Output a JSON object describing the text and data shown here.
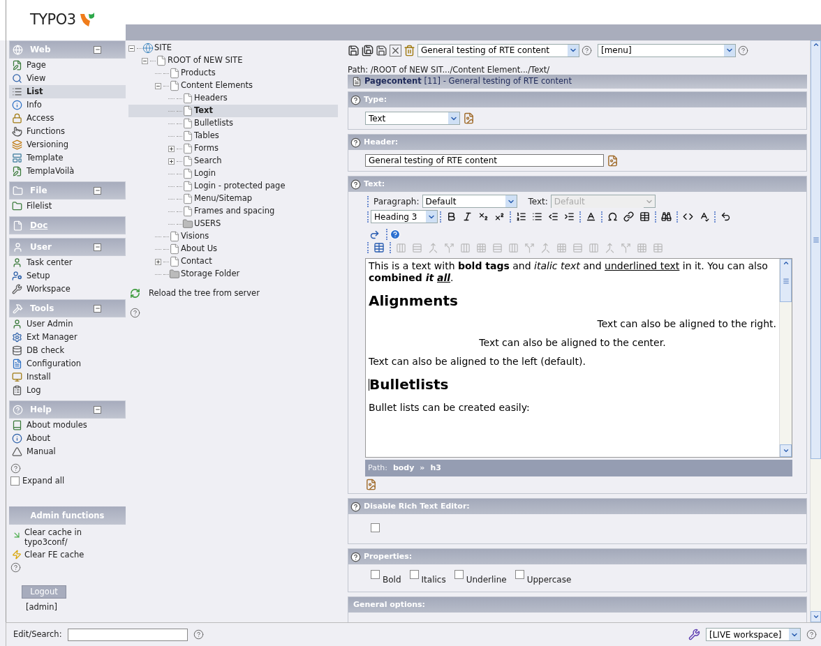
{
  "logo": {
    "text": "TYPO3"
  },
  "modules": [
    {
      "title": "Web",
      "collapsible": true,
      "link": false,
      "items": [
        {
          "label": "Page",
          "selected": false
        },
        {
          "label": "View",
          "selected": false
        },
        {
          "label": "List",
          "selected": true
        },
        {
          "label": "Info",
          "selected": false
        },
        {
          "label": "Access",
          "selected": false
        },
        {
          "label": "Functions",
          "selected": false
        },
        {
          "label": "Versioning",
          "selected": false
        },
        {
          "label": "Template",
          "selected": false
        },
        {
          "label": "TemplaVoilà",
          "selected": false
        }
      ]
    },
    {
      "title": "File",
      "collapsible": true,
      "link": false,
      "items": [
        {
          "label": "Filelist",
          "selected": false
        }
      ]
    },
    {
      "title": "Doc",
      "collapsible": false,
      "link": true
    },
    {
      "title": "User",
      "collapsible": true,
      "link": false,
      "items": [
        {
          "label": "Task center",
          "selected": false
        },
        {
          "label": "Setup",
          "selected": false
        },
        {
          "label": "Workspace",
          "selected": false
        }
      ]
    },
    {
      "title": "Tools",
      "collapsible": true,
      "link": false,
      "items": [
        {
          "label": "User Admin",
          "selected": false
        },
        {
          "label": "Ext Manager",
          "selected": false
        },
        {
          "label": "DB check",
          "selected": false
        },
        {
          "label": "Configuration",
          "selected": false
        },
        {
          "label": "Install",
          "selected": false
        },
        {
          "label": "Log",
          "selected": false
        }
      ]
    },
    {
      "title": "Help",
      "collapsible": true,
      "link": false,
      "items": [
        {
          "label": "About modules",
          "selected": false
        },
        {
          "label": "About",
          "selected": false
        },
        {
          "label": "Manual",
          "selected": false
        }
      ]
    }
  ],
  "expand_all": {
    "label": "Expand all",
    "checked": false
  },
  "admin_functions": {
    "title": "Admin functions",
    "items": [
      "Clear cache in typo3conf/",
      "Clear FE cache"
    ]
  },
  "logout": {
    "label": "Logout",
    "user": "[admin]"
  },
  "tree": {
    "root": {
      "label": "SITE",
      "kind": "site",
      "expanded": true,
      "selected": false,
      "children": [
        {
          "label": "ROOT of NEW SITE",
          "kind": "page",
          "expanded": true,
          "selected": false,
          "children": [
            {
              "label": "Products",
              "kind": "page",
              "selected": false
            },
            {
              "label": "Content Elements",
              "kind": "page",
              "expanded": true,
              "selected": false,
              "children": [
                {
                  "label": "Headers",
                  "kind": "page",
                  "selected": false
                },
                {
                  "label": "Text",
                  "kind": "page",
                  "selected": true
                },
                {
                  "label": "Bulletlists",
                  "kind": "page",
                  "selected": false
                },
                {
                  "label": "Tables",
                  "kind": "page",
                  "selected": false
                },
                {
                  "label": "Forms",
                  "kind": "page",
                  "expanded": false,
                  "selected": false
                },
                {
                  "label": "Search",
                  "kind": "page",
                  "expanded": false,
                  "selected": false
                },
                {
                  "label": "Login",
                  "kind": "page",
                  "selected": false
                },
                {
                  "label": "Login - protected page",
                  "kind": "page",
                  "selected": false
                },
                {
                  "label": "Menu/Sitemap",
                  "kind": "page",
                  "selected": false
                },
                {
                  "label": "Frames and spacing",
                  "kind": "page",
                  "selected": false
                },
                {
                  "label": "USERS",
                  "kind": "folder",
                  "selected": false
                }
              ]
            },
            {
              "label": "Visions",
              "kind": "page",
              "selected": false
            },
            {
              "label": "About Us",
              "kind": "page",
              "selected": false
            },
            {
              "label": "Contact",
              "kind": "page",
              "expanded": false,
              "selected": false
            },
            {
              "label": "Storage Folder",
              "kind": "folder",
              "selected": false
            }
          ]
        }
      ]
    }
  },
  "reload": "Reload the tree from server",
  "doc_toolbar": {
    "record_select": "General testing of RTE content",
    "menu_select": "[menu]"
  },
  "path": "Path: /ROOT of NEW SIT.../Content Element.../Text/",
  "record": {
    "type": "Pagecontent",
    "title": "[11] - General testing of RTE content"
  },
  "sections": [
    {
      "kind": "select",
      "title": "Type:",
      "value": "Text"
    },
    {
      "kind": "input",
      "title": "Header:",
      "value": "General testing of RTE content"
    },
    {
      "kind": "rte",
      "title": "Text:",
      "paragraph_label": "Paragraph:",
      "paragraph_value": "Default",
      "text_label": "Text:",
      "text_value": "Default",
      "text_disabled": true,
      "block_value": "Heading 3",
      "content": [
        {
          "kind": "paragraph",
          "align_right": false,
          "centered": false,
          "segments": [
            {
              "text": "This is a text with "
            },
            {
              "text": "bold tags",
              "bold": true
            },
            {
              "text": " and "
            },
            {
              "text": "italic text",
              "italic": true
            },
            {
              "text": " and "
            },
            {
              "text": "underlined text",
              "underline": true
            },
            {
              "text": " in it. You can also "
            },
            {
              "text": "combined ",
              "bold": true
            },
            {
              "text": "it ",
              "bold": true,
              "italic": true
            },
            {
              "text": "all",
              "bold": true,
              "italic": true,
              "underline": true
            },
            {
              "text": "."
            }
          ]
        },
        {
          "kind": "heading",
          "text": "Alignments",
          "caret": false
        },
        {
          "kind": "paragraph",
          "align_right": true,
          "centered": false,
          "segments": [
            {
              "text": "Text can also be aligned to the right."
            }
          ]
        },
        {
          "kind": "paragraph",
          "align_right": false,
          "centered": true,
          "segments": [
            {
              "text": "Text can also be aligned to the center."
            }
          ]
        },
        {
          "kind": "paragraph",
          "align_right": false,
          "centered": false,
          "segments": [
            {
              "text": "Text can also be aligned to the left (default)."
            }
          ]
        },
        {
          "kind": "heading",
          "text": "Bulletlists",
          "caret": true
        },
        {
          "kind": "paragraph",
          "align_right": false,
          "centered": false,
          "segments": [
            {
              "text": "Bullet lists can be created easily:"
            }
          ]
        }
      ],
      "status": {
        "label": "Path:",
        "items": [
          "body",
          "h3"
        ],
        "separator": "»"
      }
    },
    {
      "kind": "checkbox",
      "title": "Disable Rich Text Editor:",
      "checked": false
    },
    {
      "kind": "checkboxes",
      "title": "Properties:",
      "options": [
        {
          "label": "Bold",
          "checked": false
        },
        {
          "label": "Italics",
          "checked": false
        },
        {
          "label": "Underline",
          "checked": false
        },
        {
          "label": "Uppercase",
          "checked": false
        }
      ]
    },
    {
      "kind": "cut",
      "title": "General options:"
    }
  ],
  "bottom": {
    "search_label": "Edit/Search:",
    "workspace": "[LIVE workspace]"
  }
}
